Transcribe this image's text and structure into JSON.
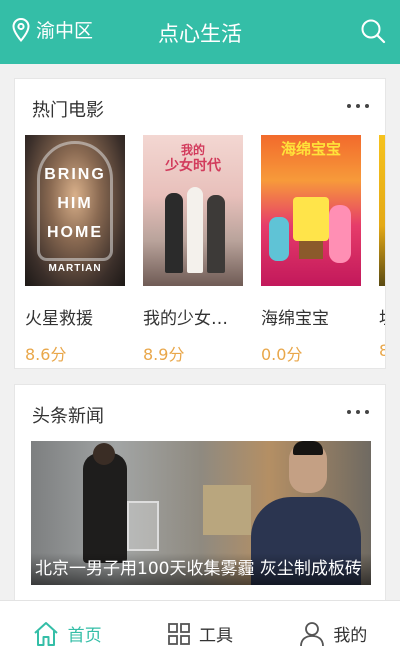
{
  "header": {
    "location": "渝中区",
    "title": "点心生活"
  },
  "movies_section": {
    "title": "热门电影",
    "items": [
      {
        "name": "火星救援",
        "score": "8.6分",
        "poster_text": [
          "BRING",
          "HIM",
          "HOME"
        ],
        "poster_subtext": "MARTIAN"
      },
      {
        "name": "我的少女…",
        "score": "8.9分",
        "poster_text": [
          "我的",
          "少女时代"
        ]
      },
      {
        "name": "海绵宝宝",
        "score": "0.0分",
        "poster_text": [
          "海绵宝宝"
        ]
      },
      {
        "name": "坦",
        "score": "8"
      }
    ]
  },
  "news_section": {
    "title": "头条新闻",
    "headline": "北京一男子用100天收集雾霾 灰尘制成板砖"
  },
  "bottom_nav": {
    "items": [
      {
        "label": "首页",
        "icon": "home-icon",
        "active": true
      },
      {
        "label": "工具",
        "icon": "grid-icon",
        "active": false
      },
      {
        "label": "我的",
        "icon": "user-icon",
        "active": false
      }
    ]
  },
  "colors": {
    "accent": "#34bea7",
    "score": "#e9a74a"
  }
}
